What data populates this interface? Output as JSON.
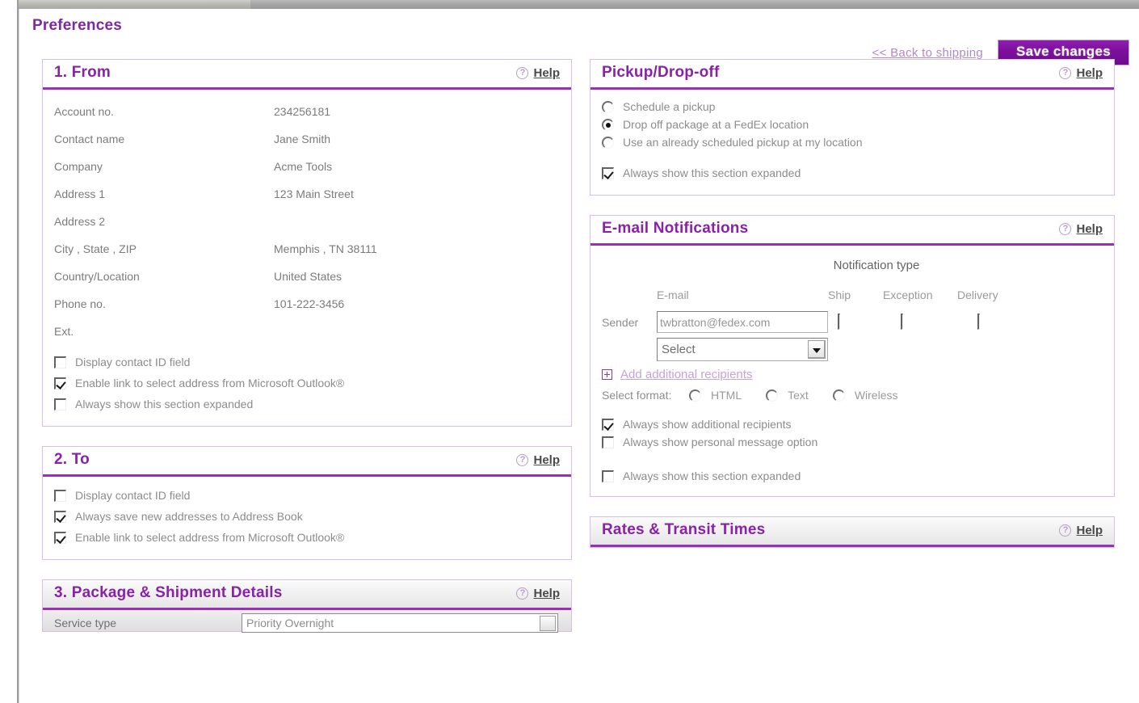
{
  "page": {
    "title": "Preferences"
  },
  "topbar": {
    "back_link": "<< Back to shipping",
    "save_button": "Save changes"
  },
  "help": {
    "label": "Help",
    "icon": "question-circle-icon"
  },
  "colors": {
    "accent_purple": "#9b30b8",
    "title_purple": "#7d2a9c",
    "link_lavender": "#c6a3d8",
    "panel_border": "#d9bfe4",
    "text_gray": "#8c8c8c"
  },
  "sections": {
    "from": {
      "title": "1. From",
      "fields": [
        {
          "label": "Account no.",
          "value": "234256181"
        },
        {
          "label": "Contact name",
          "value": "Jane Smith"
        },
        {
          "label": "Company",
          "value": "Acme Tools"
        },
        {
          "label": "Address 1",
          "value": "123 Main Street"
        },
        {
          "label": "Address 2",
          "value": ""
        },
        {
          "label": "City , State , ZIP",
          "value": "Memphis , TN 38111"
        },
        {
          "label": "Country/Location",
          "value": "United States"
        },
        {
          "label": "Phone no.",
          "value": "101-222-3456"
        },
        {
          "label": "Ext.",
          "value": ""
        }
      ],
      "checkboxes": [
        {
          "label": "Display contact ID field",
          "checked": false
        },
        {
          "label": "Enable link to select address from Microsoft Outlook®",
          "checked": true
        },
        {
          "label": "Always show this section expanded",
          "checked": false
        }
      ]
    },
    "to": {
      "title": "2. To",
      "checkboxes": [
        {
          "label": "Display contact ID field",
          "checked": false
        },
        {
          "label": "Always save new addresses to Address Book",
          "checked": true
        },
        {
          "label": "Enable link to select address from Microsoft Outlook®",
          "checked": true
        }
      ]
    },
    "package": {
      "title": "3. Package & Shipment Details",
      "service_type_label": "Service type",
      "service_type_value": "Priority Overnight"
    },
    "pickup": {
      "title": "Pickup/Drop-off",
      "radios": [
        {
          "label": "Schedule a pickup",
          "checked": false
        },
        {
          "label": "Drop off package at a FedEx location",
          "checked": true
        },
        {
          "label": "Use an already scheduled pickup at my location",
          "checked": false
        }
      ],
      "checkboxes": [
        {
          "label": "Always show this section expanded",
          "checked": true
        }
      ]
    },
    "email": {
      "title": "E-mail Notifications",
      "notification_type_header": "Notification type",
      "columns": {
        "email": "E-mail",
        "ship": "Ship",
        "exception": "Exception",
        "delivery": "Delivery"
      },
      "sender_label": "Sender",
      "sender_email": "twbratton@fedex.com",
      "sender_checks": {
        "ship": false,
        "exception": false,
        "delivery": false
      },
      "recipient_select_value": "Select",
      "add_recipients_link": "Add additional recipients",
      "format_label": "Select format:",
      "format_options": [
        {
          "label": "HTML",
          "checked": false
        },
        {
          "label": "Text",
          "checked": false
        },
        {
          "label": "Wireless",
          "checked": false
        }
      ],
      "checkboxes": [
        {
          "label": "Always show additional recipients",
          "checked": true
        },
        {
          "label": "Always show personal message option",
          "checked": false
        },
        {
          "label": "Always show this section expanded",
          "checked": false
        }
      ]
    },
    "rates": {
      "title": "Rates & Transit Times"
    }
  }
}
